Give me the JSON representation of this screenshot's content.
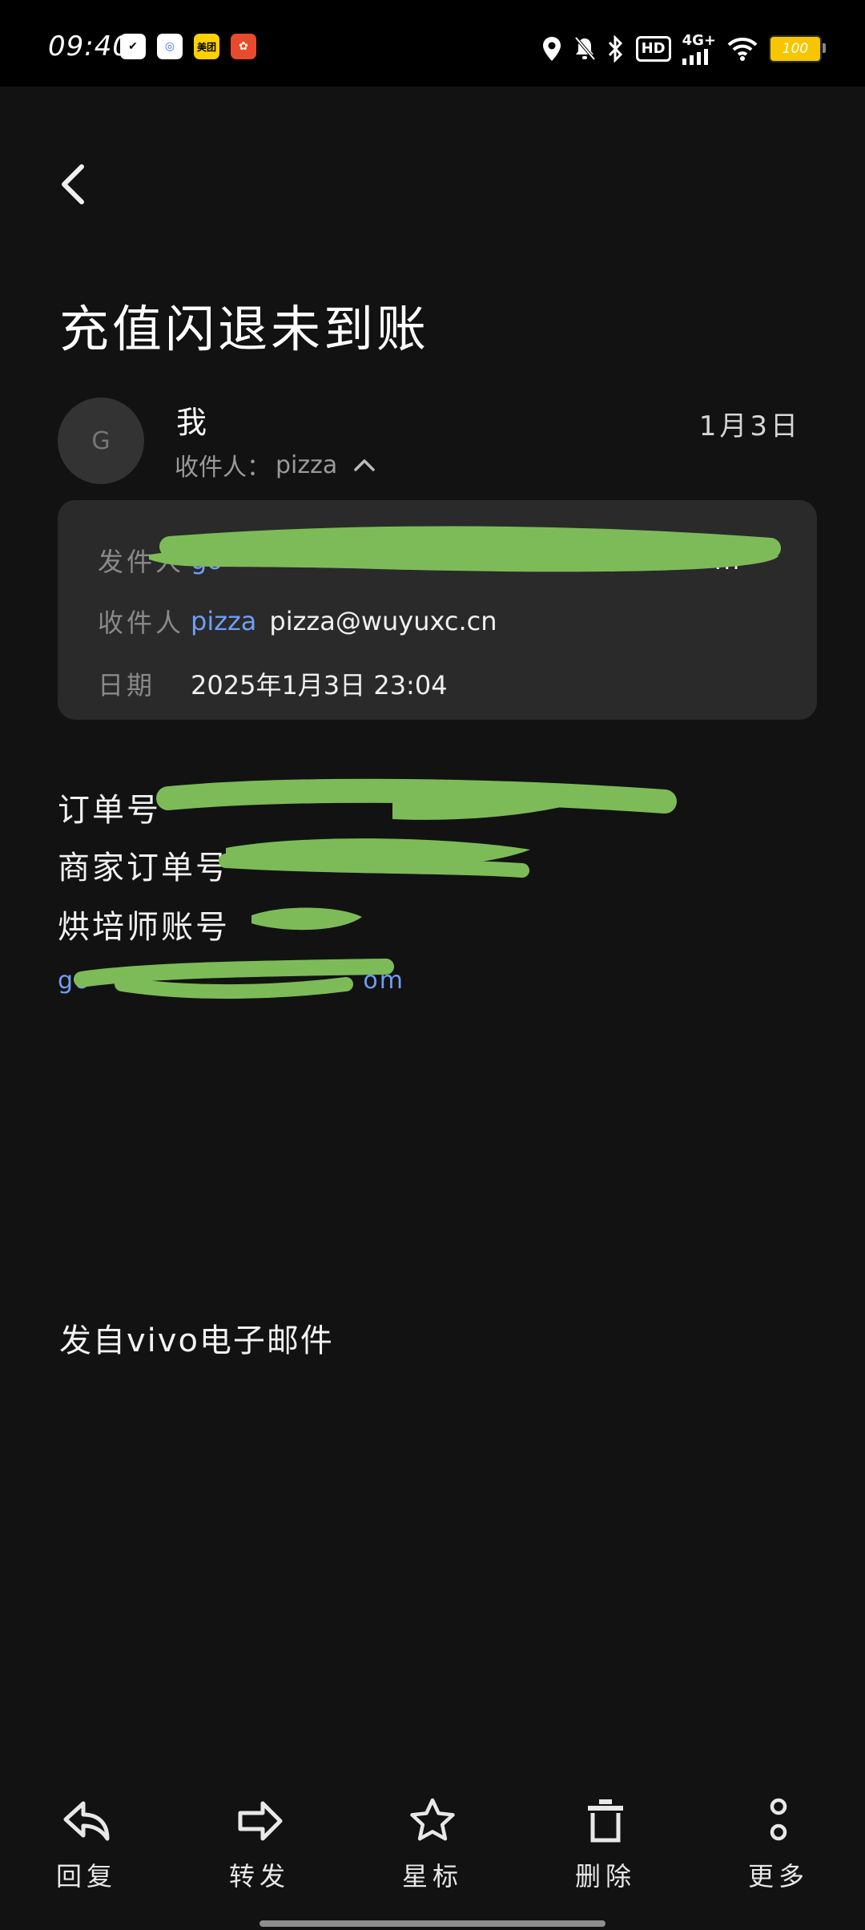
{
  "status_bar": {
    "time": "09:40",
    "battery": "100",
    "network": "4G+",
    "hd": "HD",
    "apps": [
      "clipboard-icon",
      "baidu-netdisk-icon",
      "美团",
      "game-icon"
    ]
  },
  "email": {
    "subject": "充值闪退未到账",
    "avatar_letter": "G",
    "sender_name": "我",
    "recipient_label": "收件人：",
    "recipient_name": "pizza",
    "date_short": "1月3日",
    "details": {
      "from_label": "发件人",
      "from_value": "go",
      "from_tail": "m",
      "to_label": "收件人",
      "to_name": "pizza",
      "to_email": "pizza@wuyuxc.cn",
      "date_label": "日期",
      "date_value": "2025年1月3日 23:04"
    },
    "body": {
      "line1": "订单号",
      "line2": "商家订单号",
      "line3": "烘培师账号",
      "line4_start": "go",
      "line4_end": "om"
    },
    "signature": "发自vivo电子邮件"
  },
  "actions": [
    {
      "label": "回复",
      "icon": "reply-icon"
    },
    {
      "label": "转发",
      "icon": "forward-icon"
    },
    {
      "label": "星标",
      "icon": "star-icon"
    },
    {
      "label": "删除",
      "icon": "trash-icon"
    },
    {
      "label": "更多",
      "icon": "more-icon"
    }
  ],
  "colors": {
    "background": "#121212",
    "card": "#2a2a2a",
    "link": "#6f9ef5",
    "redaction": "#7dbb58"
  }
}
